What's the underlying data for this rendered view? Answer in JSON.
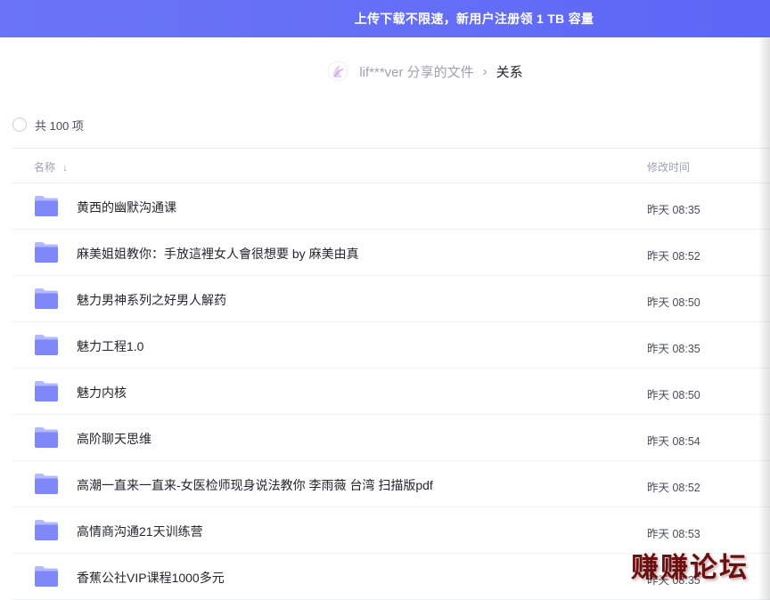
{
  "banner": {
    "text": "上传下载不限速，新用户注册领 1 TB 容量"
  },
  "breadcrumb": {
    "owner": "lif***ver 分享的文件",
    "separator": "›",
    "current": "关系"
  },
  "summary": {
    "count_label": "共 100 项"
  },
  "table": {
    "header_name": "名称",
    "header_time": "修改时间",
    "rows": [
      {
        "name": "黄西的幽默沟通课",
        "time": "昨天 08:35"
      },
      {
        "name": "麻美姐姐教你：手放這裡女人會很想要 by 麻美由真",
        "time": "昨天 08:52"
      },
      {
        "name": "魅力男神系列之好男人解药",
        "time": "昨天 08:50"
      },
      {
        "name": "魅力工程1.0",
        "time": "昨天 08:35"
      },
      {
        "name": "魅力内核",
        "time": "昨天 08:50"
      },
      {
        "name": "高阶聊天思维",
        "time": "昨天 08:54"
      },
      {
        "name": "高潮一直来一直来-女医检师现身说法教你 李雨薇 台湾 扫描版pdf",
        "time": "昨天 08:52"
      },
      {
        "name": "高情商沟通21天训练营",
        "time": "昨天 08:53"
      },
      {
        "name": "香蕉公社VIP课程1000多元",
        "time": "昨天 08:35"
      }
    ]
  },
  "watermark": {
    "text": "赚赚论坛"
  },
  "icons": {
    "folder": "folder-icon",
    "sort": "sort-arrow-down-icon",
    "avatar": "user-avatar"
  },
  "colors": {
    "banner": "#636df7",
    "folder_top": "#aeb4ff",
    "folder_body": "#7f88f8"
  }
}
